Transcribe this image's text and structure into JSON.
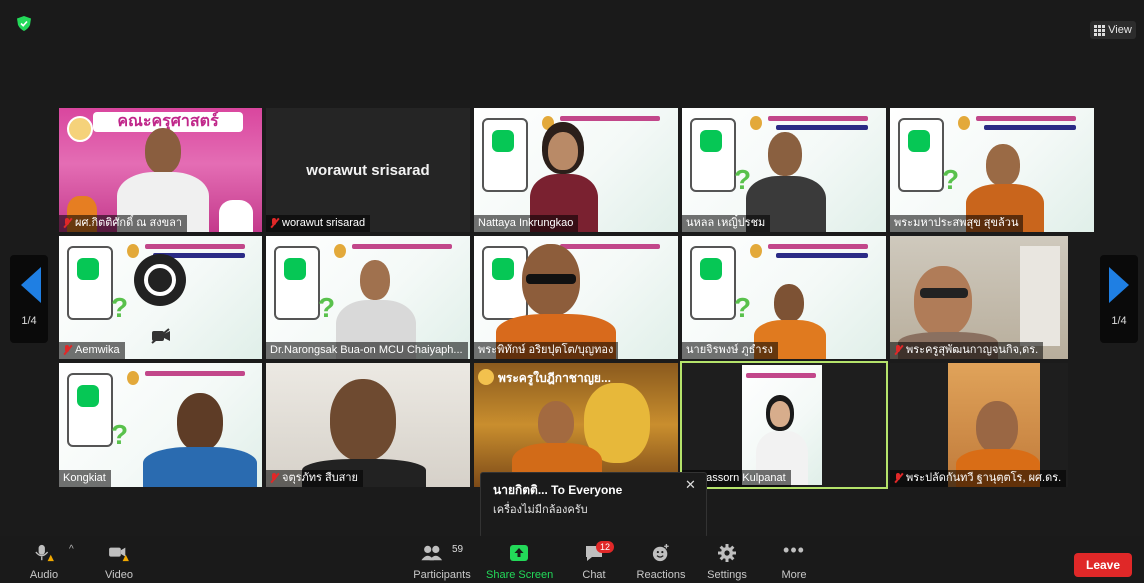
{
  "top": {
    "view_label": "View"
  },
  "pagination": {
    "left": "1/4",
    "right": "1/4"
  },
  "tiles": {
    "t1": {
      "name": "ผศ.กิตติศักดิ์ ณ สงขลา",
      "banner": "คณะครุศาสตร์"
    },
    "t2": {
      "name": "worawut srisarad",
      "display": "worawut srisarad"
    },
    "t3": {
      "name": "Nattaya Inkrungkao"
    },
    "t4": {
      "name": "นหลล เหญิ๋ปรชม"
    },
    "t5": {
      "name": "พระมหาประสพสุข สุขล้วน"
    },
    "t6": {
      "name": "Aemwika"
    },
    "t7": {
      "name": "Dr.Narongsak Bua-on MCU Chaiyaph..."
    },
    "t8": {
      "name": "พระพิทักษ์ อริยปุตโต/บุญทอง"
    },
    "t9": {
      "name": "นายจิรพงษ์ ภูธำรง"
    },
    "t10": {
      "name": "พระครูสุพัฒนกาญจนกิจ,ดร."
    },
    "t11": {
      "name": "Kongkiat"
    },
    "t12": {
      "name": "จตุรภัทร สืบสาย"
    },
    "t13": {
      "name": "พระครูใบฎีกาชาญย..."
    },
    "t14": {
      "name": "Napassorn Kulpanat"
    },
    "t15": {
      "name": "พระปลัดกันทวี ฐานุตฺตโร, ผศ.ดร."
    }
  },
  "chat_popup": {
    "from": "นายกิตติ... To Everyone",
    "message": "เครื่องไม่มีกล้องครับ"
  },
  "toolbar": {
    "audio": "Audio",
    "video": "Video",
    "participants": "Participants",
    "participants_count": "59",
    "share_screen": "Share Screen",
    "chat": "Chat",
    "chat_badge": "12",
    "reactions": "Reactions",
    "settings": "Settings",
    "more": "More",
    "leave": "Leave"
  },
  "colors": {
    "accent_green": "#23d959",
    "danger_red": "#e02828",
    "arrow_blue": "#1f7fe3",
    "active_speaker": "#b5e36b"
  }
}
